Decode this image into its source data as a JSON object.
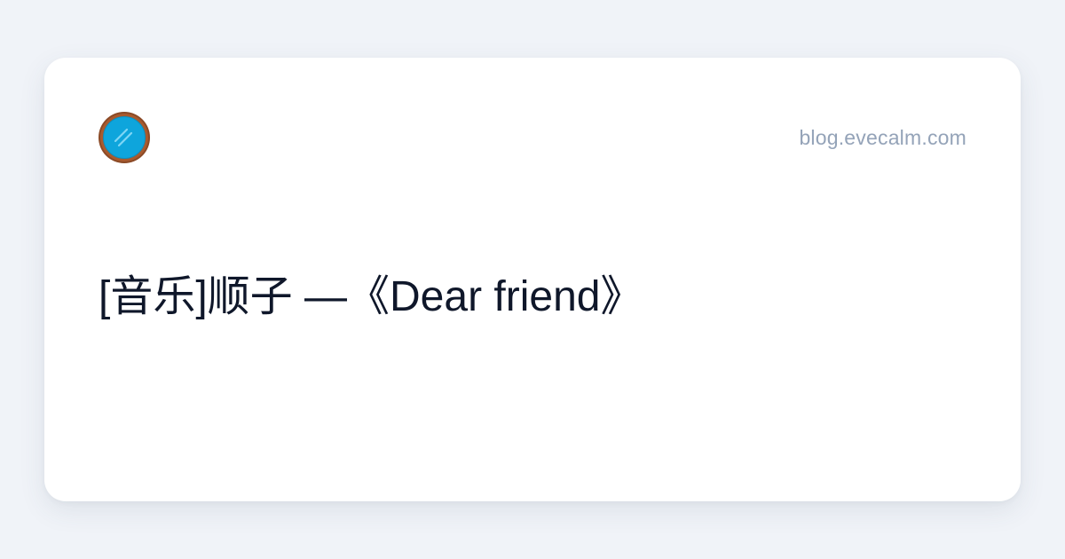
{
  "site": {
    "url": "blog.evecalm.com",
    "url_color": "#94a3b8",
    "logo_icon": "glass-mirror-icon",
    "logo_colors": {
      "frame": "#8b4a26",
      "glass": "#0ea5dc"
    }
  },
  "post": {
    "title": "[音乐]顺子 —《Dear friend》",
    "title_color": "#0f172a"
  },
  "colors": {
    "background": "#f0f3f8",
    "card": "#ffffff"
  }
}
